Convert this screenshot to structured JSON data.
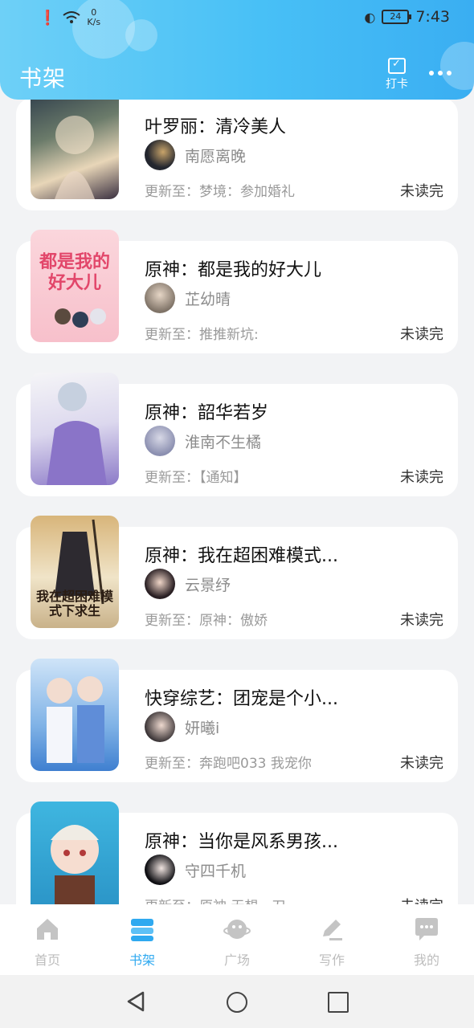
{
  "status_bar": {
    "speed_value": "0",
    "speed_unit": "K/s",
    "battery": "24",
    "time": "7:43"
  },
  "header": {
    "title": "书架",
    "checkin_label": "打卡"
  },
  "books": [
    {
      "title": "叶罗丽：清冷美人",
      "author": "南愿离晚",
      "update": "更新至：梦境：参加婚礼",
      "status": "未读完"
    },
    {
      "title": "原神：都是我的好大儿",
      "author": "芷幼晴",
      "update": "更新至：推推新坑:",
      "status": "未读完",
      "cover_text": "都是我的好大儿"
    },
    {
      "title": "原神：韶华若岁",
      "author": "淮南不生橘",
      "update": "更新至：【通知】",
      "status": "未读完"
    },
    {
      "title": "原神：我在超困难模式...",
      "author": "云景纾",
      "update": "更新至：原神：傲娇",
      "status": "未读完",
      "cover_text": "我在超困难模式下求生"
    },
    {
      "title": "快穿综艺：团宠是个小...",
      "author": "妍曦i",
      "update": "更新至：奔跑吧033 我宠你",
      "status": "未读完"
    },
    {
      "title": "原神：当你是风系男孩...",
      "author": "守四千机",
      "update": "更新至：原神 无想一刀",
      "status": "未读完"
    }
  ],
  "tabs": [
    {
      "label": "首页",
      "icon": "home-icon",
      "active": false
    },
    {
      "label": "书架",
      "icon": "bookshelf-icon",
      "active": true
    },
    {
      "label": "广场",
      "icon": "planet-icon",
      "active": false
    },
    {
      "label": "写作",
      "icon": "pen-icon",
      "active": false
    },
    {
      "label": "我的",
      "icon": "chat-bubble-icon",
      "active": false
    }
  ],
  "colors": {
    "accent": "#2fa9f0",
    "header_start": "#6ed0f7",
    "header_end": "#3aaef2"
  }
}
